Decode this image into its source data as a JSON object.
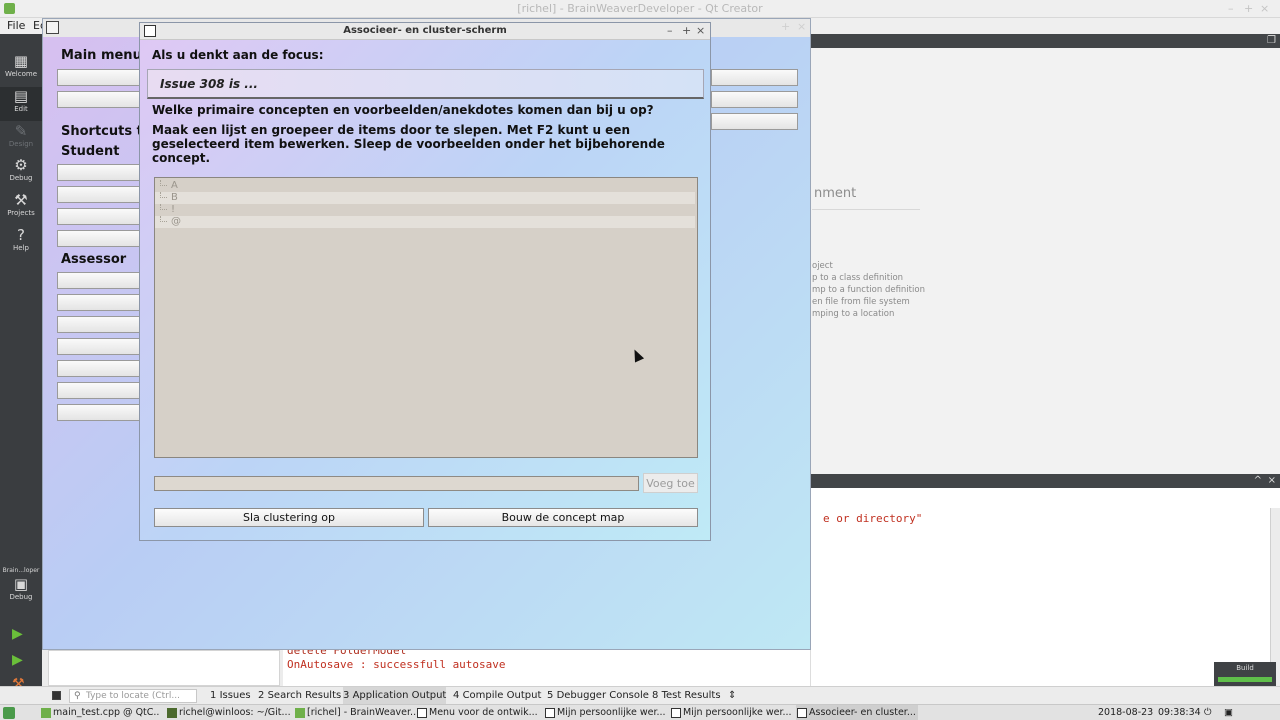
{
  "qtcreator": {
    "title": "[richel] - BrainWeaverDeveloper - Qt Creator",
    "window_controls": [
      "–",
      "+",
      "×"
    ],
    "menu": [
      "File",
      "Ed"
    ],
    "modes": [
      {
        "icon": "grid-icon",
        "glyph": "▦",
        "label": "Welcome"
      },
      {
        "icon": "edit-icon",
        "glyph": "▤",
        "label": "Edit"
      },
      {
        "icon": "design-icon",
        "glyph": "✎",
        "label": "Design"
      },
      {
        "icon": "debug-icon",
        "glyph": "⚙",
        "label": "Debug"
      },
      {
        "icon": "projects-icon",
        "glyph": "⚒",
        "label": "Projects"
      },
      {
        "icon": "help-icon",
        "glyph": "?",
        "label": "Help"
      }
    ],
    "kit": {
      "project": "Brain...loper",
      "config": "Debug"
    },
    "editor_bar_restore": "❐",
    "welcome_heading_fragment": "nment",
    "tips": [
      "oject",
      "p to a class definition",
      "mp to a function definition",
      "en file from file system",
      "mping to a location"
    ],
    "output_header_controls": {
      "restore": "^",
      "close": "×"
    },
    "output_fragment": "e or directory\"",
    "output_lines": [
      "delete FolderModel",
      "OnAutosave : successfull autosave"
    ],
    "build_label": "Build",
    "locator_placeholder": "Type to locate (Ctrl...",
    "output_tabs": [
      {
        "num": "1",
        "label": "Issues"
      },
      {
        "num": "2",
        "label": "Search Results"
      },
      {
        "num": "3",
        "label": "Application Output"
      },
      {
        "num": "4",
        "label": "Compile Output"
      },
      {
        "num": "5",
        "label": "Debugger Console"
      },
      {
        "num": "8",
        "label": "Test Results"
      }
    ],
    "output_tabs_more": "⇕"
  },
  "taskbar": {
    "items": [
      {
        "label": "main_test.cpp @ QtC...",
        "icon_color": "#6fb04a"
      },
      {
        "label": "richel@winloos: ~/Git...",
        "icon_color": "#4c6a2e"
      },
      {
        "label": "[richel] - BrainWeaver...",
        "icon_color": "#6fb04a"
      },
      {
        "label": "Menu voor de ontwik...",
        "icon_color": "#ffffff"
      },
      {
        "label": "Mijn persoonlijke wer...",
        "icon_color": "#ffffff"
      },
      {
        "label": "Mijn persoonlijke wer...",
        "icon_color": "#ffffff"
      },
      {
        "label": "Associeer- en cluster...",
        "icon_color": "#ffffff"
      }
    ],
    "date": "2018-08-23",
    "time": "09:38:34"
  },
  "brainweaver": {
    "controls": [
      "–",
      "+",
      "×"
    ],
    "sections": {
      "main_menus": "Main menus",
      "shortcuts": "Shortcuts to",
      "student": "Student",
      "assessor": "Assessor"
    }
  },
  "dialog": {
    "title": "Associeer- en cluster-scherm",
    "controls": [
      "–",
      "+",
      "×"
    ],
    "focus_label": "Als u denkt aan de focus:",
    "focus_question": "Issue 308 is ...",
    "question": "Welke primaire concepten en voorbeelden/anekdotes komen dan bij u op?",
    "instructions": "Maak een lijst en groepeer de items door te slepen. Met F2 kunt u een geselecteerd item bewerken. Sleep de voorbeelden onder het bijbehorende concept.",
    "items": [
      "A",
      "B",
      "!",
      "@"
    ],
    "new_item_value": "",
    "add_button": "Voeg toe",
    "save_button": "Sla clustering op",
    "build_button": "Bouw de concept map"
  }
}
